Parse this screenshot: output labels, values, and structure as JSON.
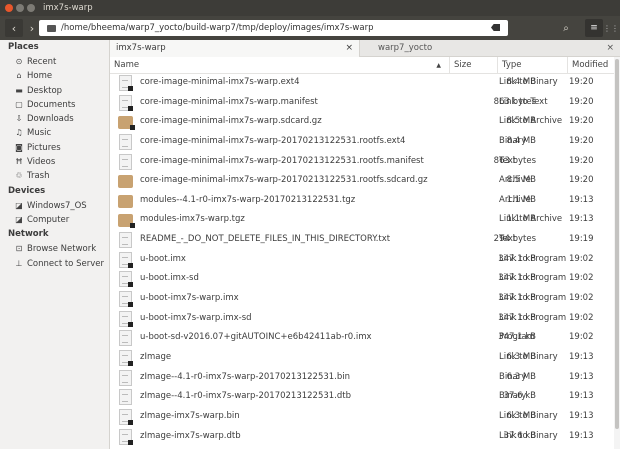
{
  "window": {
    "title": "imx7s-warp"
  },
  "toolbar": {
    "path": "/home/bheema/warp7_yocto/build-warp7/tmp/deploy/images/imx7s-warp",
    "back": "‹",
    "forward": "›",
    "search": "⌕",
    "list": "≡",
    "grid": "⋮⋮"
  },
  "sidebar": {
    "sections": [
      {
        "title": "Places",
        "items": [
          {
            "label": "Recent",
            "icon": "⊙"
          },
          {
            "label": "Home",
            "icon": "⌂"
          },
          {
            "label": "Desktop",
            "icon": "▬"
          },
          {
            "label": "Documents",
            "icon": "▢"
          },
          {
            "label": "Downloads",
            "icon": "⇩"
          },
          {
            "label": "Music",
            "icon": "♫"
          },
          {
            "label": "Pictures",
            "icon": "◙"
          },
          {
            "label": "Videos",
            "icon": "Ħ"
          },
          {
            "label": "Trash",
            "icon": "♲"
          }
        ]
      },
      {
        "title": "Devices",
        "items": [
          {
            "label": "Windows7_OS",
            "icon": "◪"
          },
          {
            "label": "Computer",
            "icon": "◪"
          }
        ]
      },
      {
        "title": "Network",
        "items": [
          {
            "label": "Browse Network",
            "icon": "⊡"
          },
          {
            "label": "Connect to Server",
            "icon": "⊥"
          }
        ]
      }
    ]
  },
  "tabs": [
    {
      "label": "imx7s-warp",
      "close": "×"
    },
    {
      "label": "warp7_yocto",
      "close": "×"
    }
  ],
  "columns": {
    "name": "Name",
    "sort": "▲",
    "size": "Size",
    "type": "Type",
    "modified": "Modified"
  },
  "files": [
    {
      "name": "core-image-minimal-imx7s-warp.ext4",
      "size": "8.4 MB",
      "type": "Link to Binary",
      "modified": "19:20",
      "icon": "doc",
      "link": true
    },
    {
      "name": "core-image-minimal-imx7s-warp.manifest",
      "size": "863 bytes",
      "type": "Link to Text",
      "modified": "19:20",
      "icon": "doc",
      "link": true
    },
    {
      "name": "core-image-minimal-imx7s-warp.sdcard.gz",
      "size": "8.5 MB",
      "type": "Link to Archive",
      "modified": "19:20",
      "icon": "arc",
      "link": true
    },
    {
      "name": "core-image-minimal-imx7s-warp-20170213122531.rootfs.ext4",
      "size": "8.4 MB",
      "type": "Binary",
      "modified": "19:20",
      "icon": "doc",
      "link": false
    },
    {
      "name": "core-image-minimal-imx7s-warp-20170213122531.rootfs.manifest",
      "size": "863 bytes",
      "type": "Text",
      "modified": "19:20",
      "icon": "doc",
      "link": false
    },
    {
      "name": "core-image-minimal-imx7s-warp-20170213122531.rootfs.sdcard.gz",
      "size": "8.5 MB",
      "type": "Archive",
      "modified": "19:20",
      "icon": "arc",
      "link": false
    },
    {
      "name": "modules--4.1-r0-imx7s-warp-20170213122531.tgz",
      "size": "1.1 MB",
      "type": "Archive",
      "modified": "19:13",
      "icon": "arc",
      "link": false
    },
    {
      "name": "modules-imx7s-warp.tgz",
      "size": "1.1 MB",
      "type": "Link to Archive",
      "modified": "19:13",
      "icon": "arc",
      "link": true
    },
    {
      "name": "README_-_DO_NOT_DELETE_FILES_IN_THIS_DIRECTORY.txt",
      "size": "294 bytes",
      "type": "Text",
      "modified": "19:19",
      "icon": "doc",
      "link": false
    },
    {
      "name": "u-boot.imx",
      "size": "347.1 kB",
      "type": "Link to Program",
      "modified": "19:02",
      "icon": "doc",
      "link": true
    },
    {
      "name": "u-boot.imx-sd",
      "size": "347.1 kB",
      "type": "Link to Program",
      "modified": "19:02",
      "icon": "doc",
      "link": true
    },
    {
      "name": "u-boot-imx7s-warp.imx",
      "size": "347.1 kB",
      "type": "Link to Program",
      "modified": "19:02",
      "icon": "doc",
      "link": true
    },
    {
      "name": "u-boot-imx7s-warp.imx-sd",
      "size": "347.1 kB",
      "type": "Link to Program",
      "modified": "19:02",
      "icon": "doc",
      "link": true
    },
    {
      "name": "u-boot-sd-v2016.07+gitAUTOINC+e6b42411ab-r0.imx",
      "size": "347.1 kB",
      "type": "Program",
      "modified": "19:02",
      "icon": "doc",
      "link": false
    },
    {
      "name": "zImage",
      "size": "6.3 MB",
      "type": "Link to Binary",
      "modified": "19:13",
      "icon": "doc",
      "link": true
    },
    {
      "name": "zImage--4.1-r0-imx7s-warp-20170213122531.bin",
      "size": "6.3 MB",
      "type": "Binary",
      "modified": "19:13",
      "icon": "doc",
      "link": false
    },
    {
      "name": "zImage--4.1-r0-imx7s-warp-20170213122531.dtb",
      "size": "37.6 kB",
      "type": "Binary",
      "modified": "19:13",
      "icon": "doc",
      "link": false
    },
    {
      "name": "zImage-imx7s-warp.bin",
      "size": "6.3 MB",
      "type": "Link to Binary",
      "modified": "19:13",
      "icon": "doc",
      "link": true
    },
    {
      "name": "zImage-imx7s-warp.dtb",
      "size": "37.6 kB",
      "type": "Link to Binary",
      "modified": "19:13",
      "icon": "doc",
      "link": true
    }
  ]
}
